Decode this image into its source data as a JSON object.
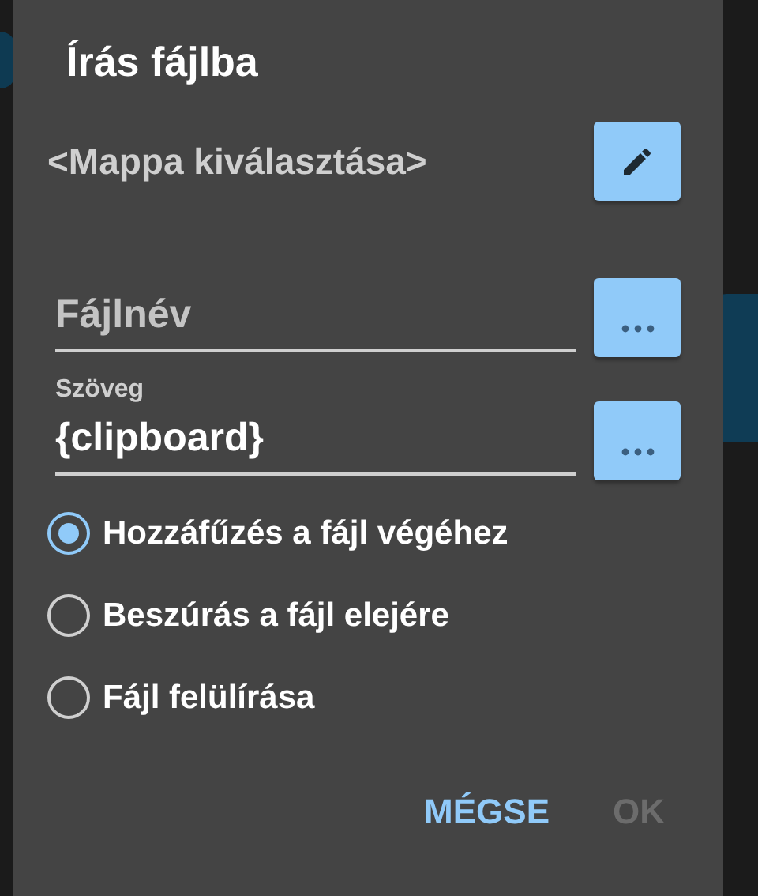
{
  "dialog": {
    "title": "Írás fájlba",
    "folder": {
      "label": "<Mappa kiválasztása>"
    },
    "fields": [
      {
        "placeholder": "Fájlnév"
      },
      {
        "label": "Szöveg",
        "value": "{clipboard}"
      }
    ],
    "options": [
      {
        "label": "Hozzáfűzés a fájl végéhez",
        "selected": true
      },
      {
        "label": "Beszúrás a fájl elejére",
        "selected": false
      },
      {
        "label": "Fájl felülírása",
        "selected": false
      }
    ],
    "actions": [
      {
        "label": "MÉGSE",
        "disabled": false
      },
      {
        "label": "OK",
        "disabled": true
      }
    ]
  }
}
